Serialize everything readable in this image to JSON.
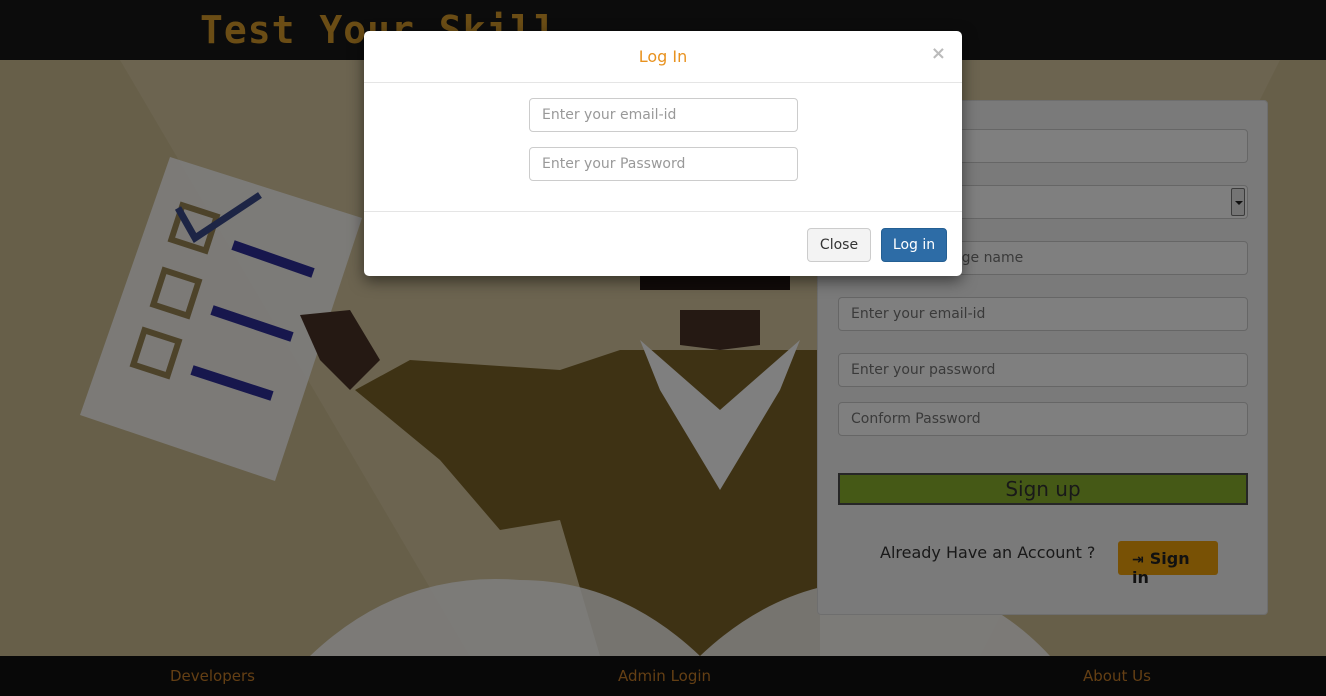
{
  "header": {
    "brand": "Test Your Skill"
  },
  "signup": {
    "field_college_placeholder": "Enter your college name",
    "field_email_placeholder": "Enter your email-id",
    "field_password_placeholder": "Enter your password",
    "field_confirm_placeholder": "Conform Password",
    "signup_label": "Sign up",
    "already_text": "Already Have an Account ?",
    "signin_label": "Sign in",
    "signin_icon": "sign-in-icon"
  },
  "footer": {
    "developers": "Developers",
    "admin_login": "Admin Login",
    "about_us": "About Us"
  },
  "modal": {
    "title": "Log In",
    "close_glyph": "×",
    "email_placeholder": "Enter your email-id",
    "password_placeholder": "Enter your Password",
    "close_label": "Close",
    "login_label": "Log in"
  },
  "colors": {
    "brand": "#d69a2b",
    "accent_orange": "#e8921f",
    "signup_green": "#8ab22c",
    "signin_orange": "#f0a30a",
    "login_blue": "#2d6ca6"
  }
}
